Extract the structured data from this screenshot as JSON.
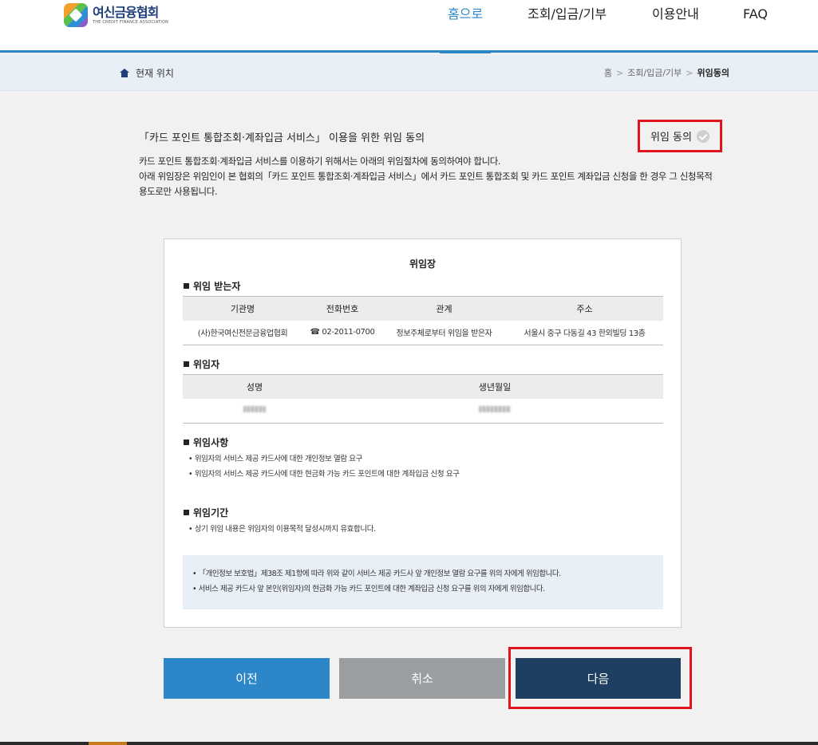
{
  "header": {
    "logo_name": "여신금융협회",
    "logo_sub": "THE CREDIT FINANCE ASSOCIATION",
    "nav": [
      {
        "label": "홈으로",
        "active": true
      },
      {
        "label": "조회/입금/기부",
        "active": false
      },
      {
        "label": "이용안내",
        "active": false
      },
      {
        "label": "FAQ",
        "active": false
      }
    ]
  },
  "location": {
    "label": "현재 위치",
    "breadcrumb": [
      "홈",
      "조회/입금/기부",
      "위임동의"
    ],
    "separator": ">"
  },
  "intro": {
    "title": "「카드 포인트 통합조회·계좌입금 서비스」 이용을 위한 위임 동의",
    "consent_label": "위임 동의",
    "desc_line1": "카드 포인트 통합조회·계좌입금 서비스를 이용하기 위해서는 아래의 위임절차에 동의하여야 합니다.",
    "desc_line2": "아래 위임장은 위임인이 본 협회의「카드 포인트 통합조회·계좌입금 서비스」에서 카드 포인트 통합조회 및 카드 포인트 계좌입금 신청을 한 경우 그 신청목적 용도로만 사용됩니다."
  },
  "document": {
    "title": "위임장",
    "recipient": {
      "heading": "위임 받는자",
      "columns": [
        "기관명",
        "전화번호",
        "관계",
        "주소"
      ],
      "row": [
        "(사)한국여신전문금융업협회",
        "☎ 02-2011-0700",
        "정보주체로부터 위임을 받은자",
        "서울시 중구 다동길 43 한외빌딩 13층"
      ]
    },
    "delegator": {
      "heading": "위임자",
      "columns": [
        "성명",
        "생년월일"
      ]
    },
    "matters": {
      "heading": "위임사항",
      "items": [
        "• 위임자의 서비스 제공 카드사에 대한 개인정보 열람 요구",
        "• 위임자의 서비스 제공 카드사에 대한 현금화 가능 카드 포인트에 대한 계좌입금 신청 요구"
      ]
    },
    "period": {
      "heading": "위임기간",
      "items": [
        "• 상기 위임 내용은 위임자의 이용목적 달성시까지 유효합니다."
      ]
    },
    "notice": [
      "• 「개인정보 보호법」제38조 제1항에 따라 위와 같이 서비스 제공 카드사 앞 개인정보 열람 요구를 위의 자에게 위임합니다.",
      "• 서비스 제공 카드사 앞 본인(위임자)의 현금화 가능 카드 포인트에 대한 계좌입금 신청 요구를 위의 자에게 위임합니다."
    ]
  },
  "buttons": {
    "prev": "이전",
    "cancel": "취소",
    "next": "다음"
  },
  "colors": {
    "accent": "#2c86c8",
    "navy": "#1f3f62",
    "highlight_red": "#e0151b",
    "cancel_gray": "#9a9ea1"
  }
}
